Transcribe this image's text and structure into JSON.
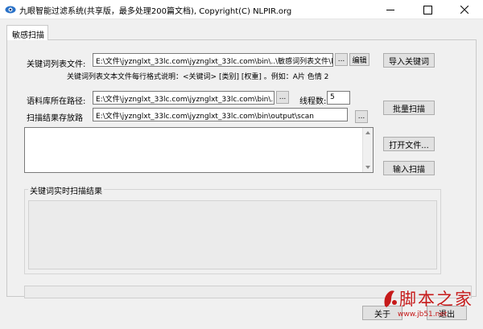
{
  "window": {
    "title": "九眼智能过滤系统(共享版，最多处理200篇文档), Copyright(C) NLPIR.org",
    "icon": "app-eye-icon"
  },
  "tabs": [
    {
      "label": "敏感扫描",
      "selected": true
    }
  ],
  "keyword_file": {
    "label": "关键词列表文件:",
    "value": "E:\\文件\\jyznglxt_33lc.com\\jyznglxt_33lc.com\\bin\\..\\敏感词列表文件\\keylist.txt",
    "browse_label": "...",
    "edit_label": "编辑",
    "format_note": "关键词列表文本文件每行格式说明：<关键词> [类别] [权重] 。例如：A片 色情 2"
  },
  "import_button": {
    "label": "导入关键词"
  },
  "corpus_path": {
    "label": "语料库所在路径:",
    "value": "E:\\文件\\jyznglxt_33lc.com\\jyznglxt_33lc.com\\bin\\..\\演示语料",
    "browse_label": "..."
  },
  "threads": {
    "label": "线程数:",
    "value": "5"
  },
  "batch_scan_button": {
    "label": "批量扫描"
  },
  "result_path": {
    "label": "扫描结果存放路",
    "value": "E:\\文件\\jyznglxt_33lc.com\\jyznglxt_33lc.com\\bin\\output\\scan",
    "browse_label": "..."
  },
  "input_text": {
    "value": ""
  },
  "open_file_button": {
    "label": "打开文件..."
  },
  "input_scan_button": {
    "label": "输入扫描"
  },
  "realtime_group": {
    "title": "关键词实时扫描结果"
  },
  "footer": {
    "about_label": "关于",
    "exit_label": "退出"
  },
  "watermark": {
    "main": "脚本之家",
    "sub": "www.jb51.net"
  },
  "colors": {
    "window_bg": "#f0f0f0",
    "button_bg": "#e1e1e1",
    "watermark": "#c61a1a"
  }
}
